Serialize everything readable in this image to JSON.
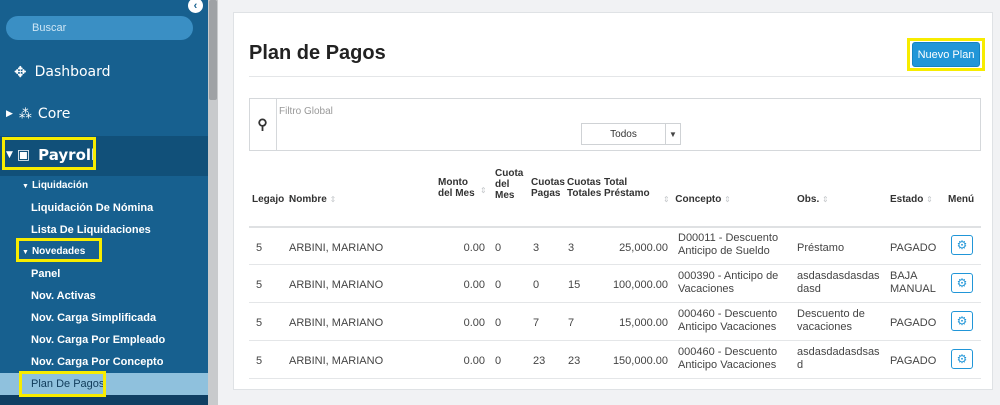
{
  "sidebar": {
    "search_placeholder": "Buscar",
    "dashboard_label": "Dashboard",
    "core_label": "Core",
    "payroll_label": "Payroll",
    "items": [
      {
        "label": "Liquidación",
        "group": true
      },
      {
        "label": "Liquidación De Nómina"
      },
      {
        "label": "Lista De Liquidaciones"
      },
      {
        "label": "Novedades",
        "group": true
      },
      {
        "label": "Panel"
      },
      {
        "label": "Nov. Activas"
      },
      {
        "label": "Nov. Carga Simplificada"
      },
      {
        "label": "Nov. Carga Por Empleado"
      },
      {
        "label": "Nov. Carga Por Concepto"
      },
      {
        "label": "Plan De Pagos",
        "active": true
      }
    ]
  },
  "page": {
    "title": "Plan de Pagos",
    "new_button": "Nuevo Plan",
    "filter_placeholder": "Filtro Global",
    "status_filter": "Todos"
  },
  "table": {
    "headers": {
      "legajo": "Legajo",
      "nombre": "Nombre",
      "monto": "Monto del Mes",
      "cuota": "Cuota del Mes",
      "cuotas_pagas": "Cuotas Pagas",
      "cuotas_totales": "Cuotas Totales",
      "total": "Total Préstamo",
      "concepto": "Concepto",
      "obs": "Obs.",
      "estado": "Estado",
      "menu": "Menú"
    },
    "rows": [
      {
        "legajo": "5",
        "nombre": "ARBINI, MARIANO",
        "monto": "0.00",
        "cuota": "0",
        "pagas": "3",
        "totales": "3",
        "total": "25,000.00",
        "concepto": "D00011 - Descuento Anticipo de Sueldo",
        "obs": "Préstamo",
        "estado": "PAGADO"
      },
      {
        "legajo": "5",
        "nombre": "ARBINI, MARIANO",
        "monto": "0.00",
        "cuota": "0",
        "pagas": "0",
        "totales": "15",
        "total": "100,000.00",
        "concepto": "000390 - Anticipo de Vacaciones",
        "obs": "asdasdasdasdasdasd",
        "estado": "BAJA MANUAL"
      },
      {
        "legajo": "5",
        "nombre": "ARBINI, MARIANO",
        "monto": "0.00",
        "cuota": "0",
        "pagas": "7",
        "totales": "7",
        "total": "15,000.00",
        "concepto": "000460 - Descuento Anticipo Vacaciones",
        "obs": "Descuento de vacaciones",
        "estado": "PAGADO"
      },
      {
        "legajo": "5",
        "nombre": "ARBINI, MARIANO",
        "monto": "0.00",
        "cuota": "0",
        "pagas": "23",
        "totales": "23",
        "total": "150,000.00",
        "concepto": "000460 - Descuento Anticipo Vacaciones",
        "obs": "asdasdadasdsasd",
        "estado": "PAGADO"
      }
    ]
  },
  "colors": {
    "sidebar": "#17608f",
    "accent": "#2196d8",
    "highlight": "#f7ec00"
  }
}
